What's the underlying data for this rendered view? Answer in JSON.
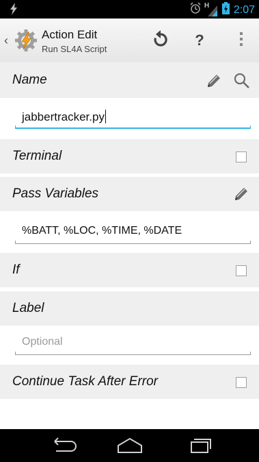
{
  "status_bar": {
    "time": "2:07",
    "signal_label": "H",
    "icons": [
      "tasker-bolt-icon",
      "alarm-icon",
      "signal-icon",
      "battery-icon"
    ]
  },
  "action_bar": {
    "title": "Action Edit",
    "subtitle": "Run SL4A Script",
    "help_label": "?",
    "icons": [
      "up-chevron-icon",
      "tasker-logo-icon",
      "reset-icon",
      "help-icon",
      "overflow-icon"
    ]
  },
  "form": {
    "name": {
      "label": "Name",
      "value": "jabbertracker.py"
    },
    "terminal": {
      "label": "Terminal",
      "checked": false
    },
    "pass_variables": {
      "label": "Pass Variables",
      "value": "%BATT, %LOC, %TIME, %DATE"
    },
    "if": {
      "label": "If",
      "checked": false
    },
    "label": {
      "label": "Label",
      "placeholder": "Optional"
    },
    "continue_after_error": {
      "label": "Continue Task After Error",
      "checked": false
    }
  },
  "nav_bar": {
    "icons": [
      "back-icon",
      "home-icon",
      "recents-icon"
    ]
  },
  "colors": {
    "accent": "#33b5e5",
    "header_bg": "#efefef",
    "status_bar_bg": "#000000"
  }
}
